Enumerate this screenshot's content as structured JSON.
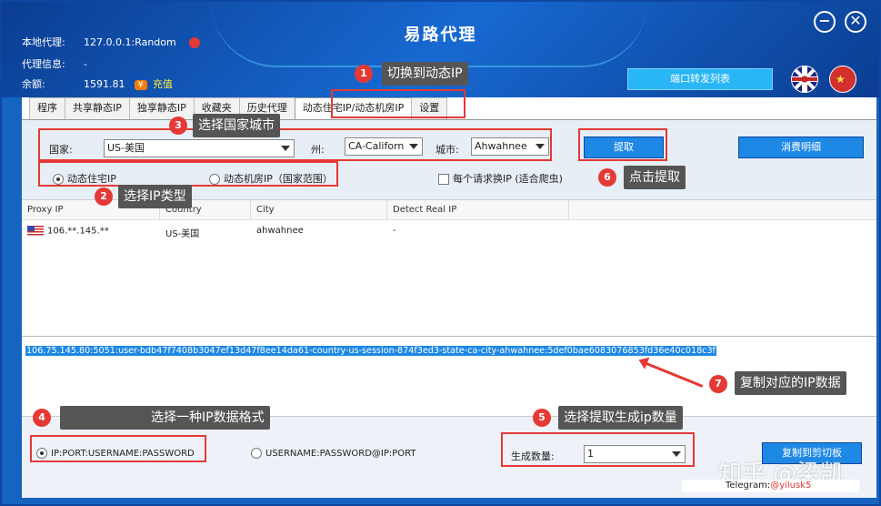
{
  "window": {
    "title": "易路代理",
    "minimize_symbol": "−",
    "close_symbol": "✕"
  },
  "info": {
    "local_proxy_label": "本地代理:",
    "local_proxy_value": "127.0.0.1:Random",
    "proxy_info_label": "代理信息:",
    "proxy_info_value": "-",
    "balance_label": "余额:",
    "balance_value": "1591.81",
    "yen_symbol": "¥",
    "recharge_label": "充值"
  },
  "header": {
    "port_forward_button": "端口转发列表",
    "flag_cn_star": "★"
  },
  "tabs": [
    {
      "label": "程序"
    },
    {
      "label": "共享静态IP"
    },
    {
      "label": "独享静态IP"
    },
    {
      "label": "收藏夹"
    },
    {
      "label": "历史代理"
    },
    {
      "label": "动态住宅IP/动态机房IP"
    },
    {
      "label": "设置"
    }
  ],
  "filters": {
    "country_label": "国家:",
    "country_value": "US-美国",
    "state_label": "州:",
    "state_value": "CA-Californ",
    "city_label": "城市:",
    "city_value": "Ahwahnee",
    "extract_button": "提取",
    "consume_detail_button": "消费明细",
    "radio_residential": "动态住宅IP",
    "radio_datacenter": "动态机房IP（国家范围）",
    "checkbox_rotate": "每个请求换IP (适合爬虫)"
  },
  "grid": {
    "headers": [
      "Proxy IP",
      "Country",
      "City",
      "Detect Real IP"
    ],
    "rows": [
      {
        "proxy_ip": "106.**.145.**",
        "country": "US-美国",
        "city": "ahwahnee",
        "detect": "-"
      }
    ]
  },
  "output": {
    "text": "106.75.145.80:5051:user-bdb47f7408b3047ef13d47f8ee14da61-country-us-session-874f3ed3-state-ca-city-ahwahnee:5def0bae6083076853fd36e40c018c3f"
  },
  "bottom": {
    "format_1": "IP:PORT:USERNAME:PASSWORD",
    "format_2": "USERNAME:PASSWORD@IP:PORT",
    "quantity_label": "生成数量:",
    "quantity_value": "1",
    "copy_button": "复制到剪切板"
  },
  "callouts": {
    "c1_num": "1",
    "c1_text": "切换到动态IP",
    "c2_num": "2",
    "c2_text": "选择IP类型",
    "c3_num": "3",
    "c3_text": "选择国家城市",
    "c4_num": "4",
    "c4_text": "选择一种IP数据格式",
    "c5_num": "5",
    "c5_text": "选择提取生成ip数量",
    "c6_num": "6",
    "c6_text": "点击提取",
    "c7_num": "7",
    "c7_text": "复制对应的IP数据"
  },
  "watermark": {
    "text": "知乎 @梁凯",
    "telegram_label": "Telegram:",
    "telegram_handle": "@yilusk5"
  },
  "colors": {
    "header_blue": "#1565c0",
    "accent_red": "#e53935",
    "button_blue": "#1e88e5"
  }
}
